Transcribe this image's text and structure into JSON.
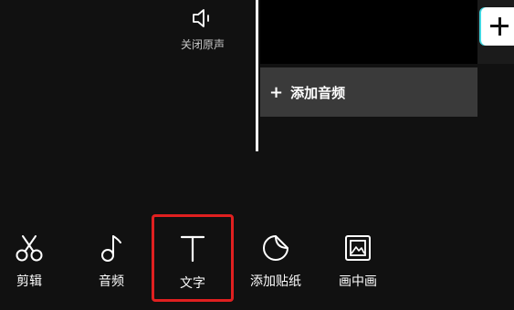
{
  "audio_controls": {
    "mute_label": "关闭原声"
  },
  "timeline": {
    "add_audio_label": "添加音频",
    "add_audio_icon": "plus"
  },
  "toolbar": {
    "items": [
      {
        "label": "剪辑",
        "icon": "scissors-icon"
      },
      {
        "label": "音频",
        "icon": "music-note-icon"
      },
      {
        "label": "文字",
        "icon": "text-icon"
      },
      {
        "label": "添加贴纸",
        "icon": "sticker-icon"
      },
      {
        "label": "画中画",
        "icon": "picture-in-picture-icon"
      }
    ]
  },
  "colors": {
    "background": "#111111",
    "highlight": "#e02020",
    "add_audio_bar": "#3a3a3a",
    "accent": "#3fd6e0"
  }
}
